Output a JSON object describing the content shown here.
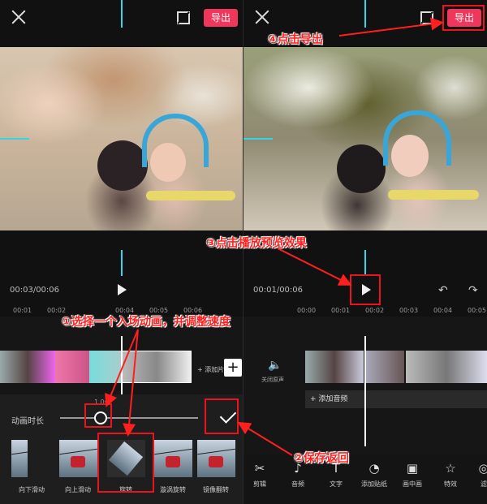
{
  "left": {
    "export_label": "导出",
    "timecode": "00:03/00:06",
    "ruler": [
      "00:01",
      "00:02",
      "00:04",
      "00:05",
      "00:06"
    ],
    "add_clip_label": "+ 添加片",
    "slider_label": "动画时长",
    "slider_value": "1.0s",
    "animations": [
      {
        "label": "向下滑动"
      },
      {
        "label": "向上滑动"
      },
      {
        "label": "旋转"
      },
      {
        "label": "漩涡旋转"
      },
      {
        "label": "镜像翻转"
      }
    ]
  },
  "right": {
    "export_label": "导出",
    "timecode": "00:01/00:06",
    "ruler": [
      "00:00",
      "00:01",
      "00:02",
      "00:03",
      "00:04",
      "00:05"
    ],
    "mute_label": "关闭原声",
    "add_audio": "+ 添加音频",
    "tools": [
      {
        "label": "剪辑",
        "icon": "scissors-icon"
      },
      {
        "label": "音频",
        "icon": "music-note-icon"
      },
      {
        "label": "文字",
        "icon": "text-icon"
      },
      {
        "label": "添加贴纸",
        "icon": "sticker-icon"
      },
      {
        "label": "画中画",
        "icon": "pip-icon"
      },
      {
        "label": "特效",
        "icon": "star-icon"
      },
      {
        "label": "滤",
        "icon": "filter-icon"
      }
    ]
  },
  "annotations": {
    "step1": "①选择一个入场动画，并调整速度",
    "step2": "②保存返回",
    "step3": "③点击播放预览效果",
    "step4": "④点击导出"
  },
  "colors": {
    "accent": "#f0365a",
    "annotation": "#ff1f1f",
    "cursor": "#37d4e8"
  }
}
